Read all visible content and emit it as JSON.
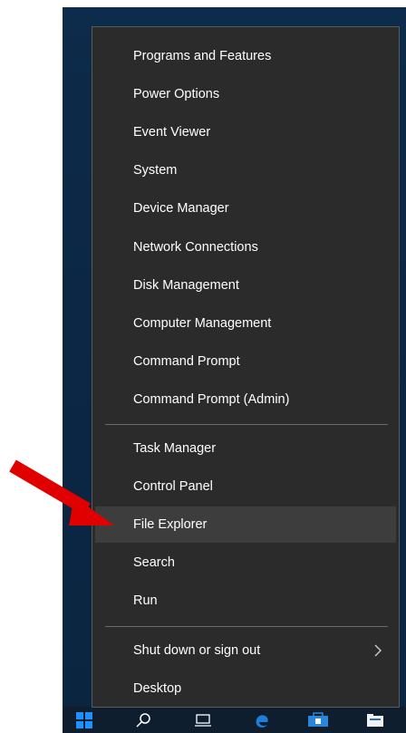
{
  "menu": {
    "items": [
      {
        "label": "Programs and Features"
      },
      {
        "label": "Power Options"
      },
      {
        "label": "Event Viewer"
      },
      {
        "label": "System"
      },
      {
        "label": "Device Manager"
      },
      {
        "label": "Network Connections"
      },
      {
        "label": "Disk Management"
      },
      {
        "label": "Computer Management"
      },
      {
        "label": "Command Prompt"
      },
      {
        "label": "Command Prompt (Admin)"
      },
      {
        "label": "Task Manager"
      },
      {
        "label": "Control Panel"
      },
      {
        "label": "File Explorer"
      },
      {
        "label": "Search"
      },
      {
        "label": "Run"
      },
      {
        "label": "Shut down or sign out"
      },
      {
        "label": "Desktop"
      }
    ],
    "highlighted": "File Explorer"
  },
  "colors": {
    "menu_bg": "#2b2b2b",
    "highlight_bg": "#3d3d3d",
    "annotation_arrow": "#e00000",
    "start_button": "#1e90ff"
  },
  "icons": {
    "submenu": "chevron-right-icon",
    "annotation": "red-arrow-icon",
    "taskbar": [
      "windows-start-icon",
      "search-icon",
      "task-view-icon",
      "edge-icon",
      "store-icon",
      "file-explorer-icon"
    ]
  }
}
